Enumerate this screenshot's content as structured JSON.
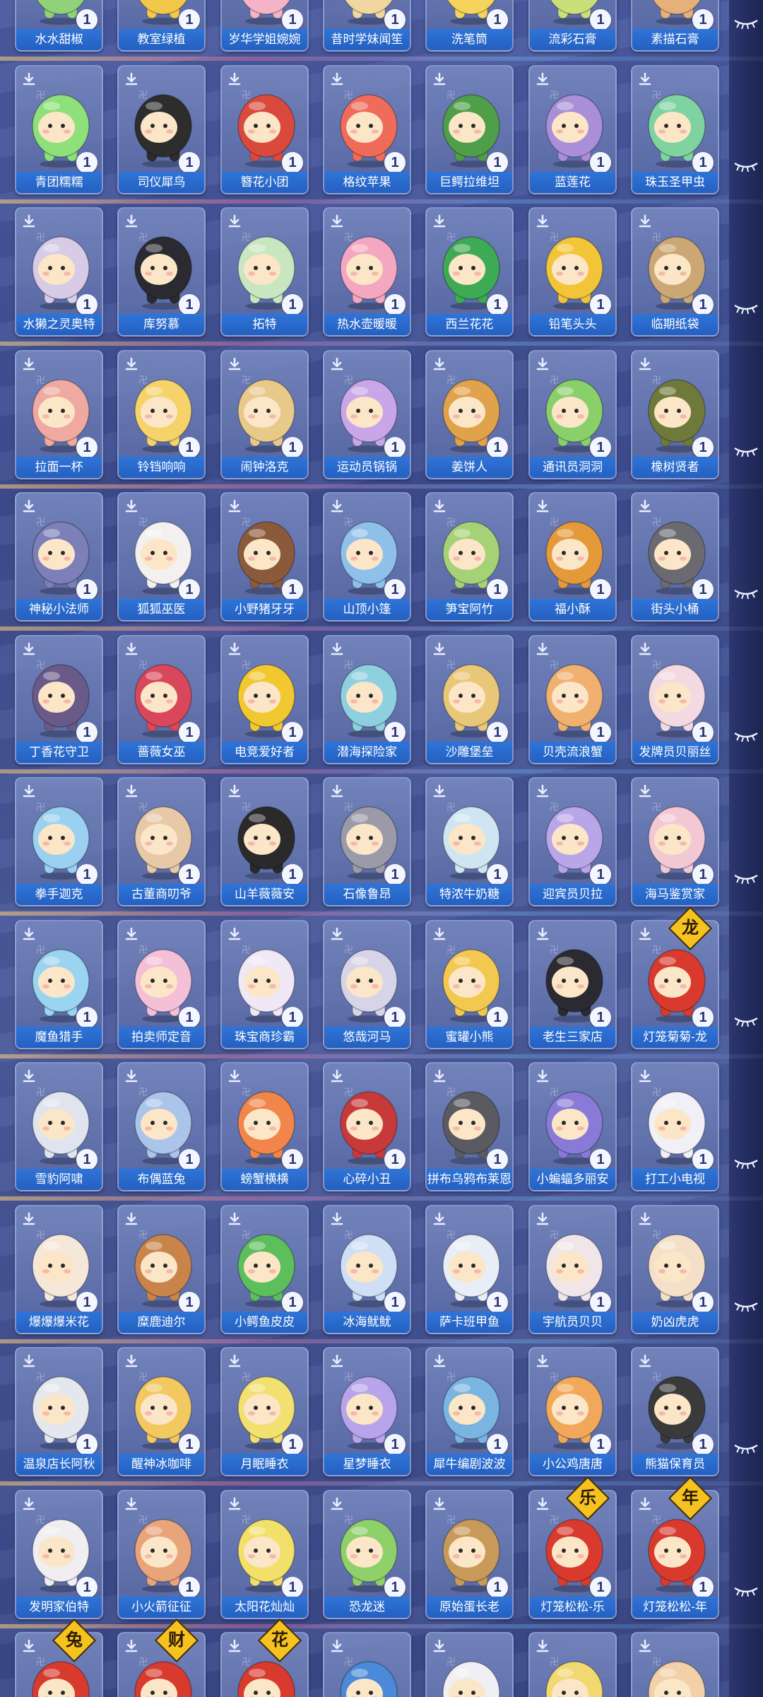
{
  "colors": {
    "label_bar": "#2f74d8",
    "card_bg": "#7686be",
    "tag": "#f6c21f",
    "badge_text": "#2a3570"
  },
  "rows": [
    {
      "names": [
        "水水甜椒",
        "教室绿植",
        "岁华学姐婉婉",
        "昔时学妹闻笙",
        "洗笔筒",
        "流彩石膏",
        "素描石膏"
      ],
      "colors": [
        "#8fd27a",
        "#f2c84b",
        "#f4b3c7",
        "#f0d7a0",
        "#f6d35a",
        "#c9e07a",
        "#e6b178"
      ]
    },
    {
      "names": [
        "青团糯糯",
        "司仪犀鸟",
        "簪花小团",
        "格纹苹果",
        "巨鳄拉维坦",
        "蓝莲花",
        "珠玉圣甲虫"
      ],
      "colors": [
        "#8ee07a",
        "#2d2d2d",
        "#d94a3c",
        "#ef6b5a",
        "#4f9e4a",
        "#a98fd8",
        "#7fd3a0"
      ]
    },
    {
      "names": [
        "水獭之灵奥特",
        "库努慕",
        "拓特",
        "热水壶暖暖",
        "西兰花花",
        "铅笔头头",
        "临期纸袋"
      ],
      "colors": [
        "#d7cbe8",
        "#2a2a30",
        "#c8e6c0",
        "#f3a7c0",
        "#3faa55",
        "#f2c438",
        "#caa775"
      ]
    },
    {
      "names": [
        "拉面一杯",
        "铃铛响响",
        "闹钟洛克",
        "运动员锅锅",
        "姜饼人",
        "通讯员洞洞",
        "橡树贤者"
      ],
      "colors": [
        "#f0a9a0",
        "#f5d36a",
        "#e9c98a",
        "#c8a6e8",
        "#e0a24a",
        "#8ad06a",
        "#6f7a3a"
      ]
    },
    {
      "names": [
        "神秘小法师",
        "狐狐巫医",
        "小野猪牙牙",
        "山顶小篷",
        "笋宝阿竹",
        "福小酥",
        "街头小桶"
      ],
      "colors": [
        "#7c7fb8",
        "#f4f0f0",
        "#8a5a3a",
        "#8fc0ea",
        "#a6d277",
        "#e59a3a",
        "#6a6a70"
      ]
    },
    {
      "names": [
        "丁香花守卫",
        "蔷薇女巫",
        "电竞爱好者",
        "潜海探险家",
        "沙雕堡垒",
        "贝壳流浪蟹",
        "发牌员贝丽丝"
      ],
      "colors": [
        "#6a5a8a",
        "#d9475a",
        "#f2c830",
        "#8fd0e0",
        "#e8c878",
        "#f0b070",
        "#f3d9e2"
      ]
    },
    {
      "names": [
        "拳手迦克",
        "古董商叨爷",
        "山羊薇薇安",
        "石像鲁昂",
        "特浓牛奶糖",
        "迎宾员贝拉",
        "海马鉴赏家"
      ],
      "colors": [
        "#9ad0f0",
        "#e7c9a8",
        "#2a2a2a",
        "#9a9aa8",
        "#cfe6f2",
        "#b8a6e8",
        "#f2c8d4"
      ]
    },
    {
      "names": [
        "魔鱼猎手",
        "拍卖师定音",
        "珠宝商珍霸",
        "悠哉河马",
        "蜜罐小熊",
        "老生三家店",
        "灯笼菊菊-龙"
      ],
      "colors": [
        "#9ad4f0",
        "#f4c0d8",
        "#f0e8f4",
        "#d8d4e8",
        "#f2c850",
        "#2a2a30",
        "#d83a2e"
      ]
    },
    {
      "names": [
        "雪豹阿啸",
        "布偶蓝兔",
        "螃蟹横横",
        "心碎小丑",
        "拼布乌鸦布莱恩",
        "小蝙蝠多丽安",
        "打工小电视"
      ],
      "colors": [
        "#dfe4ee",
        "#aac4ea",
        "#f2864a",
        "#c83a3a",
        "#5a5a60",
        "#8a7ad8",
        "#f0f0f6"
      ]
    },
    {
      "names": [
        "爆爆爆米花",
        "糜鹿迪尔",
        "小鳄鱼皮皮",
        "冰海鱿鱿",
        "萨卡班甲鱼",
        "宇航员贝贝",
        "奶凶虎虎"
      ],
      "colors": [
        "#f6e8d8",
        "#c8844a",
        "#5cbf5c",
        "#cfe0f6",
        "#e8eef6",
        "#f0e6ea",
        "#f4e0c8"
      ]
    },
    {
      "names": [
        "温泉店长阿秋",
        "醒神冰咖啡",
        "月眠睡衣",
        "星梦睡衣",
        "犀牛编剧波波",
        "小公鸡唐唐",
        "熊猫保育员"
      ],
      "colors": [
        "#e4e8ee",
        "#f2c860",
        "#f2e070",
        "#b8a4ea",
        "#7ab4e0",
        "#f2a85a",
        "#3a3a3a"
      ]
    },
    {
      "names": [
        "发明家伯特",
        "小火箭征征",
        "太阳花灿灿",
        "恐龙迷",
        "原始蛋长老",
        "灯笼松松-乐",
        "灯笼松松-年"
      ],
      "colors": [
        "#f0eef0",
        "#e8a47a",
        "#f2e06a",
        "#8ed06a",
        "#c89a5a",
        "#d83a2e",
        "#d83a2e"
      ]
    },
    {
      "names": [
        "",
        "",
        "",
        "",
        "",
        "",
        ""
      ],
      "colors": [
        "#d83a2e",
        "#d83a2e",
        "#d83a2e",
        "#4a8ad8",
        "#f0f0f4",
        "#f2d870",
        "#f2d0a8"
      ]
    }
  ],
  "tags": [
    {
      "row": 7,
      "col": 6,
      "text": "龙"
    },
    {
      "row": 11,
      "col": 5,
      "text": "乐"
    },
    {
      "row": 11,
      "col": 6,
      "text": "年"
    },
    {
      "row": 12,
      "col": 0,
      "text": "兔"
    },
    {
      "row": 12,
      "col": 1,
      "text": "财"
    },
    {
      "row": 12,
      "col": 2,
      "text": "花"
    }
  ],
  "badge_count": "1",
  "deco_mark": "卍"
}
